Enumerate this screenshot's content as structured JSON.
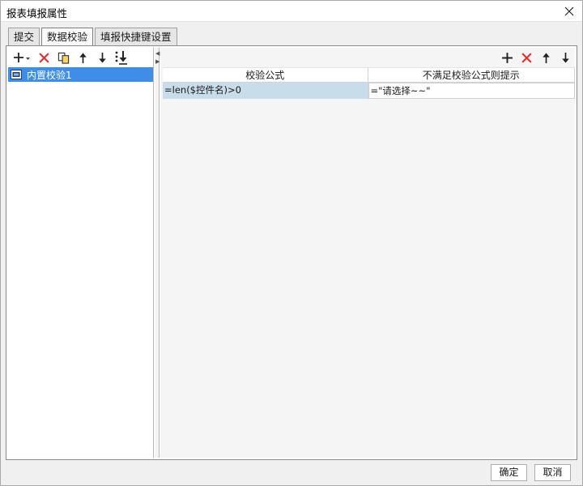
{
  "window": {
    "title": "报表填报属性",
    "close_icon": "close-icon"
  },
  "tabs": [
    {
      "label": "提交",
      "active": false
    },
    {
      "label": "数据校验",
      "active": true
    },
    {
      "label": "填报快捷键设置",
      "active": false
    }
  ],
  "left_toolbar": {
    "icons": [
      "add-icon",
      "delete-icon",
      "copy-icon",
      "move-up-icon",
      "move-down-icon",
      "move-bottom-icon"
    ],
    "colors": {
      "delete": "#e03030",
      "arrows": "#222222"
    }
  },
  "tree": {
    "items": [
      {
        "label": "内置校验1",
        "selected": true,
        "icon": "rule-icon"
      }
    ],
    "selection_color": "#3e8ee8"
  },
  "right_toolbar": {
    "icons": [
      "add-icon",
      "delete-icon",
      "move-up-icon",
      "move-down-icon"
    ]
  },
  "grid": {
    "columns": [
      "校验公式",
      "不满足校验公式则提示"
    ],
    "rows": [
      {
        "formula": "=len($控件名)>0",
        "message": "=\"请选择~~\""
      }
    ]
  },
  "buttons": {
    "ok": "确定",
    "cancel": "取消"
  }
}
